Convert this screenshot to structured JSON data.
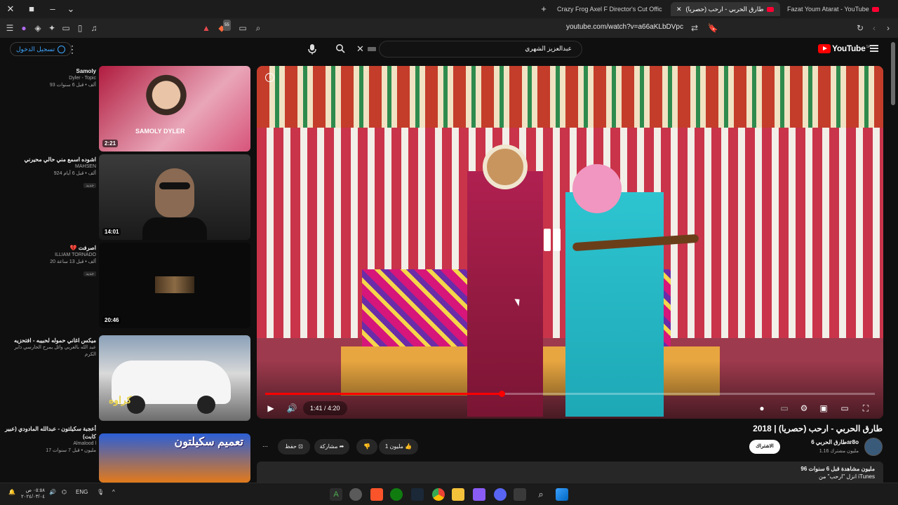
{
  "browser": {
    "tabs": [
      {
        "title": "Crazy Frog Axel F Director's Cut Offic",
        "active": false
      },
      {
        "title": "طارق الحربي - ارحب (حصريا)",
        "active": true
      },
      {
        "title": "Fazat Youm Atarat - YouTube",
        "active": false
      }
    ],
    "url": "youtube.com/watch?v=a66aKLbDVpc",
    "shield_count": "55"
  },
  "masthead": {
    "signin_label": "تسجيل الدخول",
    "search_query": "عبدالعزيز الشهري",
    "logo_text": "YouTube",
    "logo_region": "SA"
  },
  "recommendations": [
    {
      "title": "Samoly",
      "channel": "Dyler - Topic",
      "stats": "93 ألف • قبل 6 سنوات",
      "duration": "2:21",
      "thumb_text": "SAMOLY DYLER",
      "colors": [
        "#c2224a",
        "#e8a3b7"
      ]
    },
    {
      "title": "اشوده اسمع مني حالي محيرني",
      "channel": "MAHSEN",
      "stats": "924 ألف • قبل 6 أيام",
      "badge": "جديد",
      "duration": "14:01",
      "colors": [
        "#2a2a2a",
        "#5b4b40"
      ]
    },
    {
      "title": "💔 اصرفت",
      "channel": "ILLIAM TORNADO",
      "stats": "20 ألف • قبل 13 ساعة",
      "badge": "جديد",
      "duration": "20:46",
      "colors": [
        "#0c0c0c",
        "#3a2a1a"
      ]
    },
    {
      "title": "ميكس اغاني حموله لحبيبه - افتحزيه",
      "channel": "عبد الله بالعربي وائل يمرح الحارسي ذاير الكرم",
      "stats": "",
      "duration": "",
      "thumb_text": "كراوه",
      "colors": [
        "#e9e9e9",
        "#4f4f4f"
      ]
    },
    {
      "title": "أعجبة سكيلتون - عبدالله المادودي (عبير كابت)",
      "channel": "Almalood l",
      "stats": "17 مليون • قبل 7 سنوات",
      "duration": "",
      "thumb_text": "تعميم سكيلتون",
      "colors": [
        "#3b6cd8",
        "#e27a1b"
      ]
    }
  ],
  "player": {
    "current_time": "1:41",
    "duration": "4:20",
    "time_display": "1:41 / 4:20",
    "progress": 0.388,
    "state": "playing"
  },
  "video": {
    "title": "طارق الحربي - ارحب (حصريا) | 2018",
    "channel_name": "طارق الحربي 6ar8o",
    "subscribers": "1.16 مليون مشترك",
    "subscribe_label": "الاشتراك",
    "likes": "1 مليون",
    "share_label": "مشاركة",
    "save_label": "حفظ",
    "description_views": "96 مليون مشاهدة  قبل 6 سنوات",
    "description_snippet": "انزل \"ارحب\" من iTunes"
  },
  "taskbar": {
    "language": "ENG",
    "time": "٠٥:٥٨ ص",
    "date": "٢٠٢٤/٠٣/٠٤"
  },
  "colors": {
    "accent": "#ff0000",
    "link": "#3ea6ff",
    "surface": "#0f0f0f",
    "chip": "#272727"
  }
}
